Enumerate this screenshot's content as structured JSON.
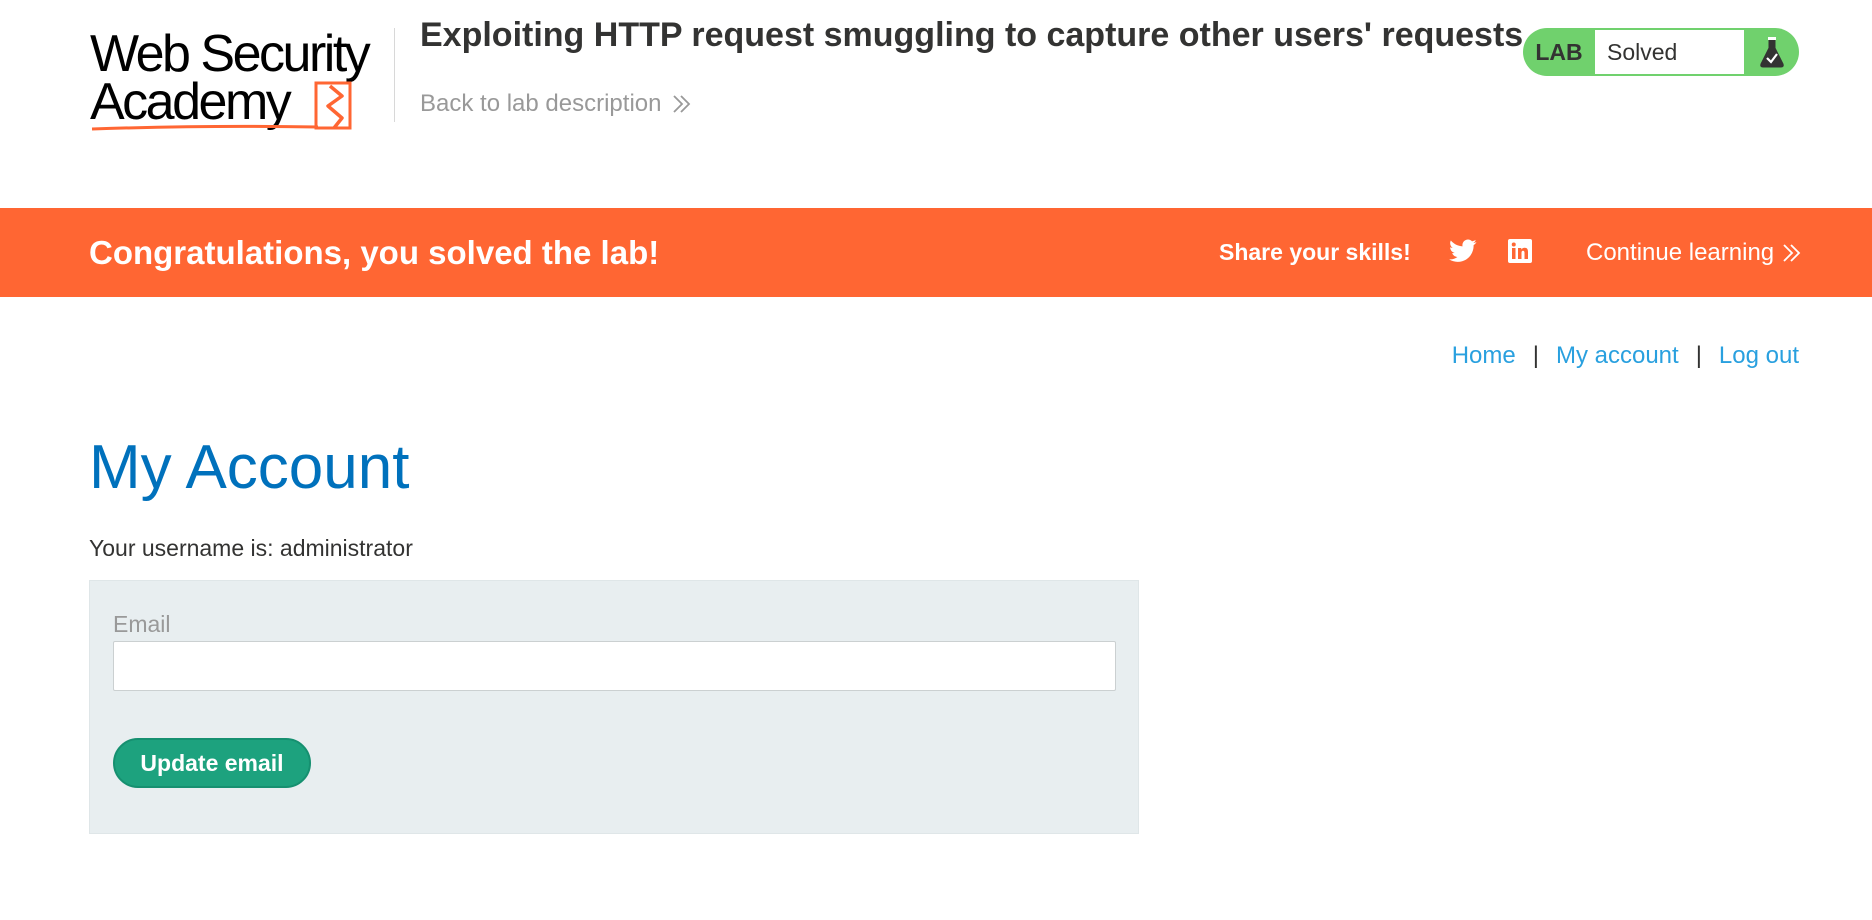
{
  "header": {
    "logo_line1": "Web Security",
    "logo_line2": "Academy",
    "lab_title": "Exploiting HTTP request smuggling to capture other users' requests",
    "back_link": "Back to lab description",
    "lab_badge": "LAB",
    "lab_status": "Solved",
    "status_icon": "flask-solved-icon"
  },
  "banner": {
    "message": "Congratulations, you solved the lab!",
    "share_label": "Share your skills!",
    "share_icons": [
      "twitter-icon",
      "linkedin-icon"
    ],
    "continue_label": "Continue learning"
  },
  "nav": {
    "home": "Home",
    "separator": "|",
    "my_account": "My account",
    "log_out": "Log out"
  },
  "account": {
    "heading": "My Account",
    "username_line": "Your username is: administrator",
    "email_label": "Email",
    "email_value": "",
    "update_button": "Update email"
  },
  "colors": {
    "banner": "#ff6633",
    "lab_solved": "#70d16d",
    "heading": "#0071bc",
    "link": "#29a0df",
    "button": "#1da27e",
    "form_bg": "#e8eef0"
  }
}
